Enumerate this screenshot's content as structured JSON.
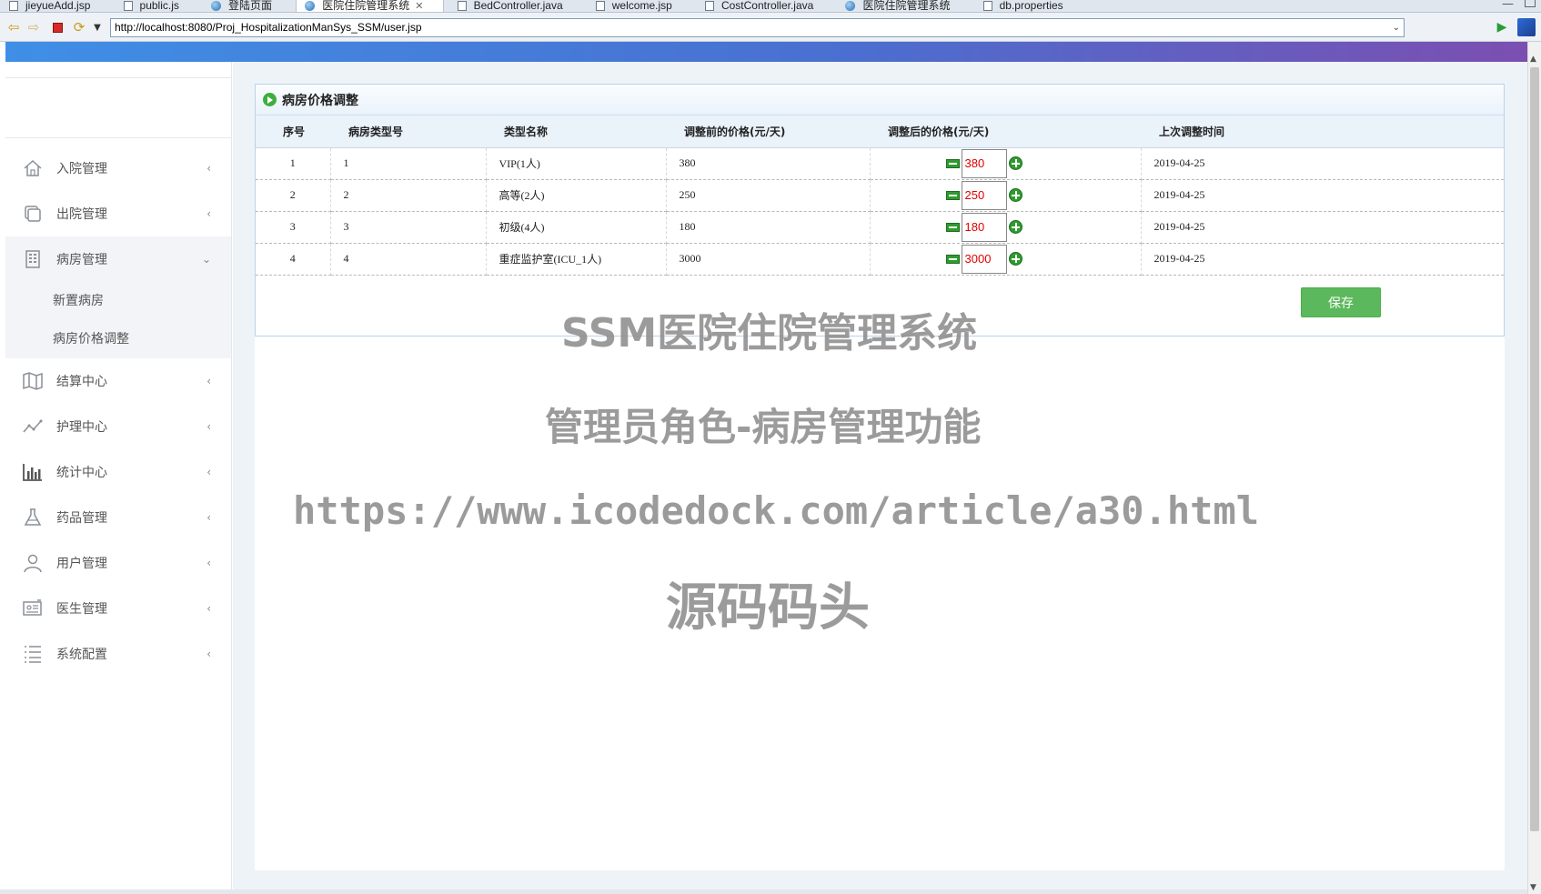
{
  "editor_tabs": [
    {
      "label": "jieyueAdd.jsp",
      "icon": "file-icon"
    },
    {
      "label": "public.js",
      "icon": "file-icon"
    },
    {
      "label": "登陆页面",
      "icon": "globe-icon"
    },
    {
      "label": "医院住院管理系统",
      "icon": "globe-icon",
      "active": true
    },
    {
      "label": "BedController.java",
      "icon": "file-icon"
    },
    {
      "label": "welcome.jsp",
      "icon": "file-icon"
    },
    {
      "label": "CostController.java",
      "icon": "file-icon"
    },
    {
      "label": "医院住院管理系统",
      "icon": "globe-icon"
    },
    {
      "label": "db.properties",
      "icon": "file-icon"
    }
  ],
  "browser": {
    "url": "http://localhost:8080/Proj_HospitalizationManSys_SSM/user.jsp"
  },
  "sidebar": {
    "items": [
      {
        "label": "入院管理",
        "icon": "home-icon",
        "caret": "‹"
      },
      {
        "label": "出院管理",
        "icon": "copy-icon",
        "caret": "‹"
      },
      {
        "label": "病房管理",
        "icon": "building-icon",
        "caret": "⌄",
        "open": true,
        "children": [
          {
            "label": "新置病房"
          },
          {
            "label": "病房价格调整"
          }
        ]
      },
      {
        "label": "结算中心",
        "icon": "map-icon",
        "caret": "‹"
      },
      {
        "label": "护理中心",
        "icon": "line-chart-icon",
        "caret": "‹"
      },
      {
        "label": "统计中心",
        "icon": "bar-chart-icon",
        "caret": "‹"
      },
      {
        "label": "药品管理",
        "icon": "flask-icon",
        "caret": "‹"
      },
      {
        "label": "用户管理",
        "icon": "user-icon",
        "caret": "‹"
      },
      {
        "label": "医生管理",
        "icon": "id-card-icon",
        "caret": "‹"
      },
      {
        "label": "系统配置",
        "icon": "list-icon",
        "caret": "‹"
      }
    ]
  },
  "panel": {
    "title": "病房价格调整",
    "columns": [
      "序号",
      "病房类型号",
      "类型名称",
      "调整前的价格(元/天)",
      "调整后的价格(元/天)",
      "上次调整时间"
    ],
    "rows": [
      {
        "idx": "1",
        "type_no": "1",
        "type_name": "VIP(1人)",
        "old_price": "380",
        "new_price": "380",
        "last_time": "2019-04-25"
      },
      {
        "idx": "2",
        "type_no": "2",
        "type_name": "高等(2人)",
        "old_price": "250",
        "new_price": "250",
        "last_time": "2019-04-25"
      },
      {
        "idx": "3",
        "type_no": "3",
        "type_name": "初级(4人)",
        "old_price": "180",
        "new_price": "180",
        "last_time": "2019-04-25"
      },
      {
        "idx": "4",
        "type_no": "4",
        "type_name": "重症监护室(ICU_1人)",
        "old_price": "3000",
        "new_price": "3000",
        "last_time": "2019-04-25"
      }
    ],
    "save_label": "保存"
  },
  "watermark": {
    "line1": "SSM医院住院管理系统",
    "line2": "管理员角色-病房管理功能",
    "line3": "https://www.icodedock.com/article/a30.html",
    "line4": "源码码头"
  },
  "colors": {
    "price_text": "#e00000",
    "save_button": "#5cb85c",
    "header_gradient_start": "#3f8fe6",
    "header_gradient_end": "#7b4fb1"
  }
}
